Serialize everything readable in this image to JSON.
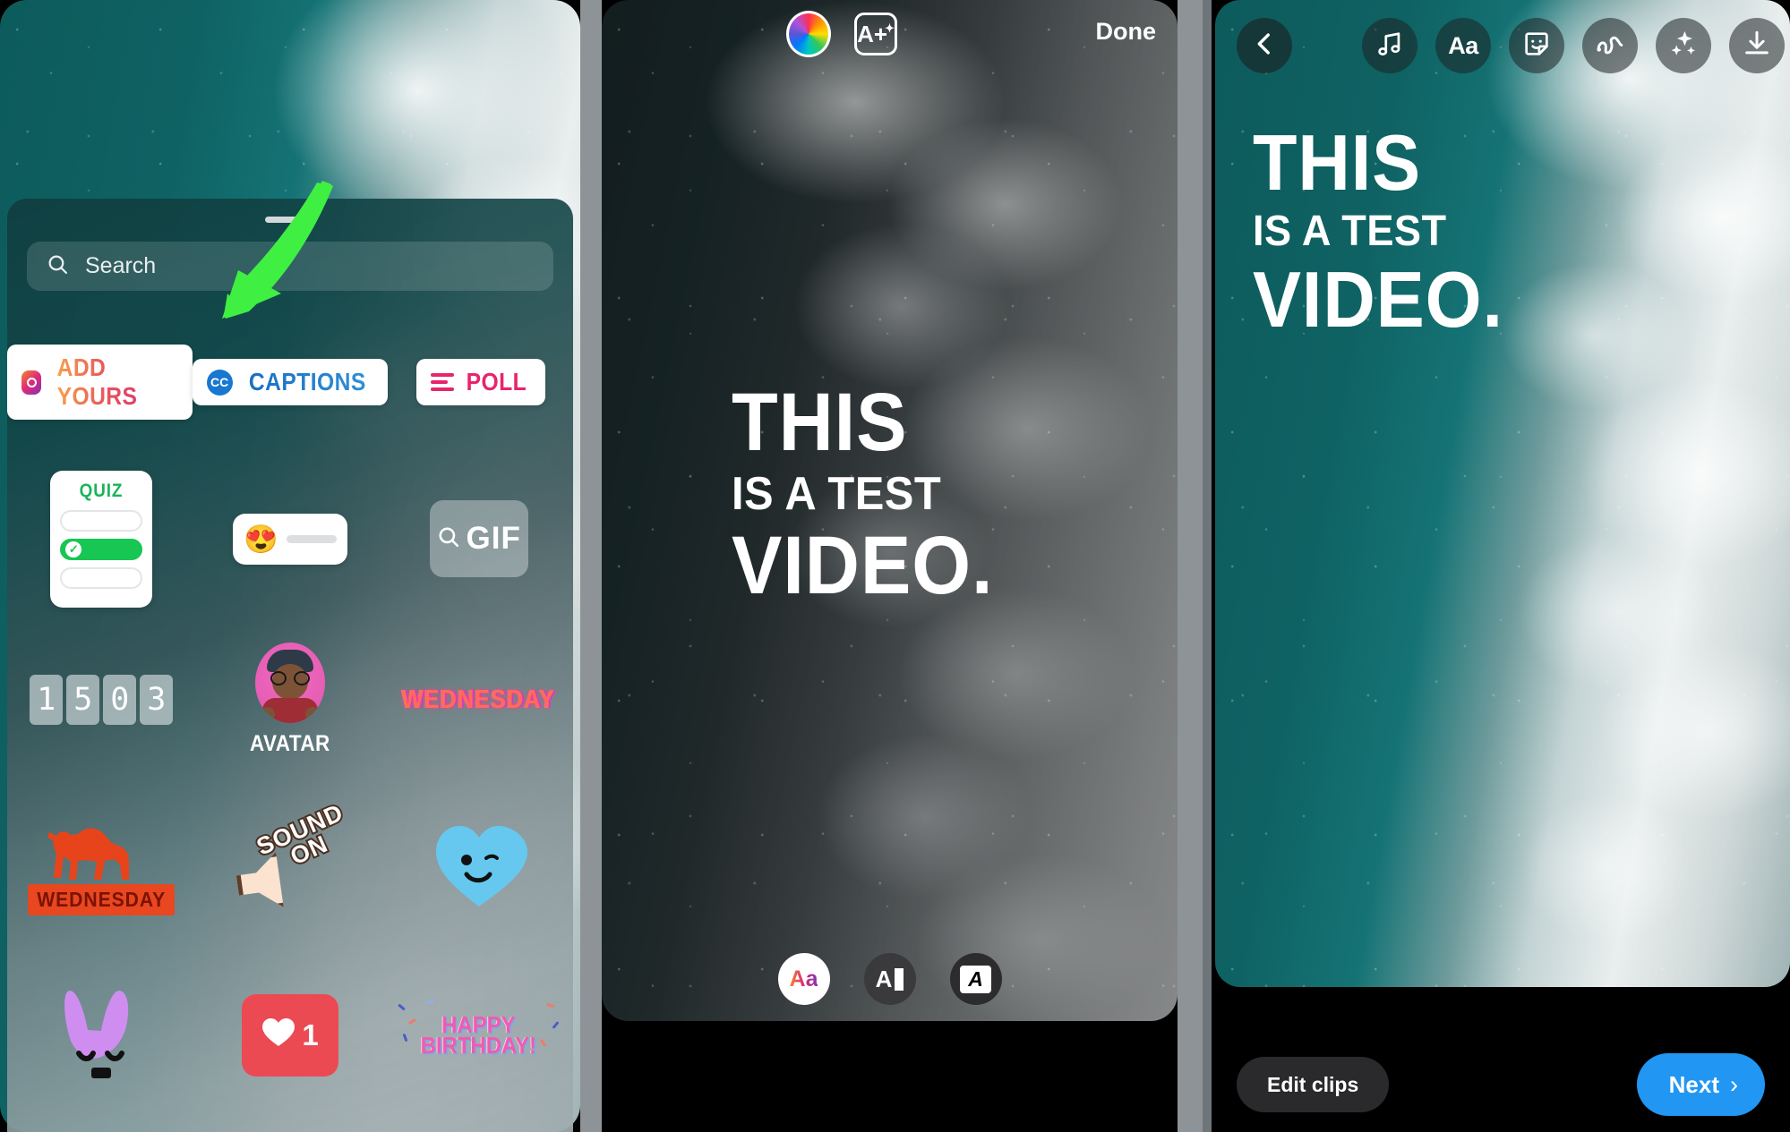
{
  "panels": {
    "left": {
      "name": "sticker-tray-panel",
      "search": {
        "placeholder": "Search",
        "icon": "search-icon"
      },
      "stickers": [
        [
          {
            "id": "add-yours",
            "label": "ADD YOURS",
            "icon": "camera-badge-icon",
            "type": "pill"
          },
          {
            "id": "captions",
            "label": "CAPTIONS",
            "icon": "cc-icon",
            "type": "pill"
          },
          {
            "id": "poll",
            "label": "POLL",
            "icon": "poll-bars-icon",
            "type": "pill"
          }
        ],
        [
          {
            "id": "quiz",
            "label": "QUIZ",
            "type": "quiz"
          },
          {
            "id": "emoji-slider",
            "label": "",
            "type": "slider",
            "emoji": "😍"
          },
          {
            "id": "gif",
            "label": "GIF",
            "type": "gif",
            "icon": "search-icon"
          }
        ],
        [
          {
            "id": "countdown",
            "label": "",
            "type": "countdown",
            "digits": [
              "1",
              "5",
              "0",
              "3"
            ]
          },
          {
            "id": "avatar",
            "label": "AVATAR",
            "type": "avatar"
          },
          {
            "id": "wednesday-neon",
            "label": "WEDNESDAY",
            "type": "neon"
          }
        ],
        [
          {
            "id": "camel-wednesday",
            "label": "WEDNESDAY",
            "type": "camel"
          },
          {
            "id": "sound-on",
            "label": "SOUND ON",
            "line1": "SOUND",
            "line2": "ON",
            "type": "soundon"
          },
          {
            "id": "blue-heart",
            "label": "",
            "type": "heart"
          }
        ],
        [
          {
            "id": "purple-bunny",
            "label": "",
            "type": "bunny"
          },
          {
            "id": "like-count",
            "label": "1",
            "type": "like"
          },
          {
            "id": "happy-birthday",
            "line1": "HAPPY",
            "line2": "BIRTHDAY!",
            "type": "hbday"
          }
        ]
      ],
      "annotation": {
        "name": "green-arrow-pointing-to-captions",
        "color": "#3ff043"
      }
    },
    "middle": {
      "name": "text-editor-panel",
      "topbar": {
        "color_wheel": "color-wheel-icon",
        "text_effects": "A+",
        "done_label": "Done"
      },
      "story_text": {
        "line1": "THIS",
        "line2": "IS A TEST",
        "line3": "VIDEO."
      },
      "style_chips": [
        {
          "id": "font-style-classic",
          "label": "Aa",
          "active": true
        },
        {
          "id": "text-align-toggle",
          "label": "A",
          "active": false
        },
        {
          "id": "text-highlight",
          "label": "A",
          "active": false
        }
      ]
    },
    "right": {
      "name": "story-preview-panel",
      "toolbar": [
        {
          "id": "back",
          "icon": "chevron-left-icon"
        },
        {
          "id": "music",
          "icon": "music-note-icon"
        },
        {
          "id": "text",
          "icon": "text-aa-icon",
          "label": "Aa"
        },
        {
          "id": "sticker",
          "icon": "sticker-smiley-icon"
        },
        {
          "id": "draw",
          "icon": "draw-squiggle-icon"
        },
        {
          "id": "effects",
          "icon": "sparkles-icon"
        },
        {
          "id": "save",
          "icon": "download-icon"
        }
      ],
      "story_text": {
        "line1": "THIS",
        "line2": "IS A TEST",
        "line3": "VIDEO."
      },
      "bottom": {
        "edit_clips_label": "Edit clips",
        "next_label": "Next",
        "next_icon": "chevron-right-icon",
        "next_color": "#2196f3"
      }
    }
  },
  "colors": {
    "ocean_teal": "#0f6263",
    "accent_blue": "#2196f3",
    "annotation_green": "#3ff043",
    "poll_pink": "#e8246c",
    "quiz_green": "#17c653"
  }
}
